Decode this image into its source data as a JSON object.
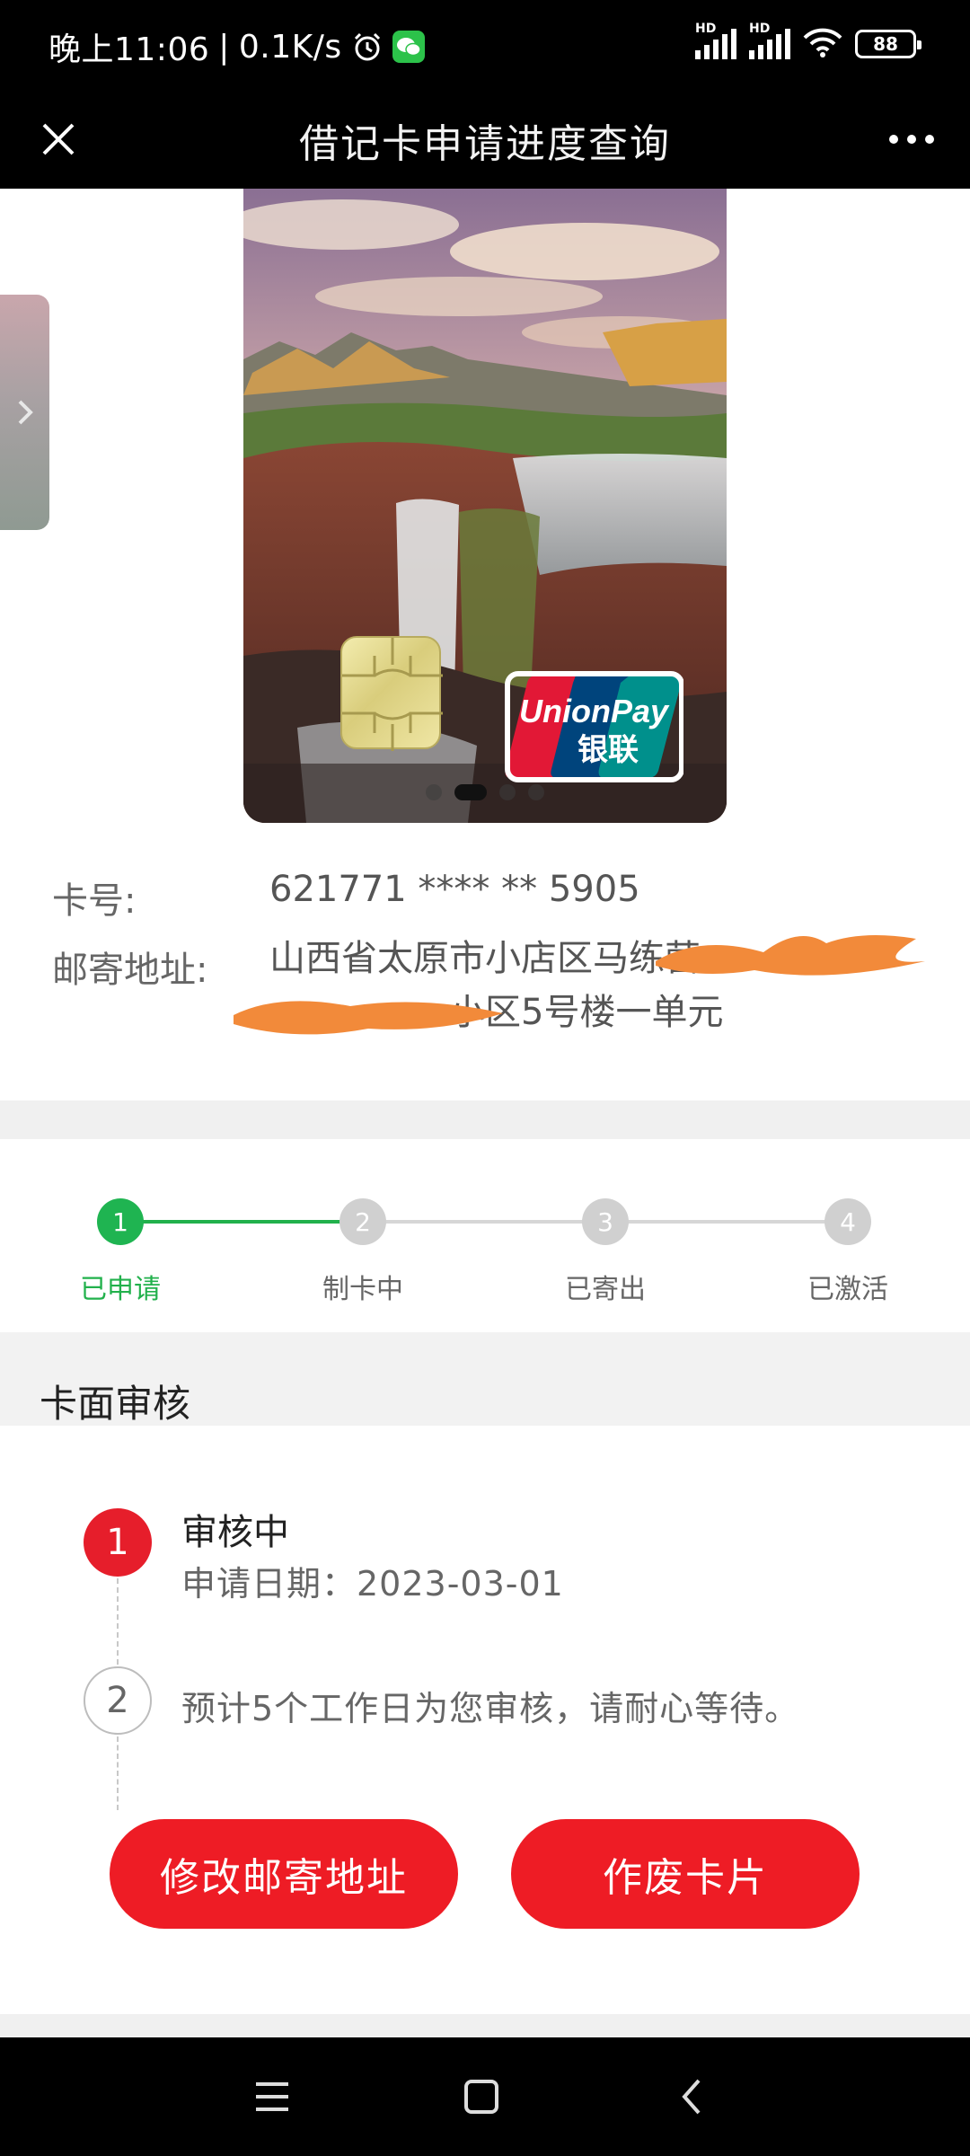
{
  "status_bar": {
    "time": "晚上11:06",
    "separator": "|",
    "speed": "0.1K/s",
    "battery": "88",
    "signal_1_label": "HD",
    "signal_2_label": "HD",
    "icons": [
      "alarm-icon",
      "wechat-icon",
      "signal-icon",
      "signal-icon",
      "wifi-icon",
      "battery-icon"
    ]
  },
  "header": {
    "title": "借记卡申请进度查询",
    "close_icon": "close-icon",
    "more_icon": "more-icon"
  },
  "card": {
    "brand_line1": "UnionPay",
    "brand_line2": "银联",
    "carousel_count": 4,
    "carousel_active_index": 1
  },
  "info": {
    "card_number_label": "卡号:",
    "card_number_value": "621771 **** ** 5905",
    "address_label": "邮寄地址:",
    "address_line1": "山西省太原市小店区马练营",
    "address_line2": "　　　　　小区5号楼一单元"
  },
  "progress": {
    "steps": [
      {
        "number": "1",
        "label": "已申请",
        "done": true
      },
      {
        "number": "2",
        "label": "制卡中",
        "done": false
      },
      {
        "number": "3",
        "label": "已寄出",
        "done": false
      },
      {
        "number": "4",
        "label": "已激活",
        "done": false
      }
    ],
    "colors": {
      "done": "#1fb451",
      "pending": "#d0d0d0"
    }
  },
  "review": {
    "section_title": "卡面审核",
    "step1_number": "1",
    "step1_title": "审核中",
    "step1_date": "申请日期：2023-03-01",
    "step2_number": "2",
    "step2_note": "预计5个工作日为您审核，请耐心等待。",
    "modify_button": "修改邮寄地址",
    "cancel_button": "作废卡片",
    "accent_color": "#ee1c25"
  },
  "nav": {
    "icons": [
      "menu-icon",
      "home-icon",
      "back-icon"
    ]
  }
}
